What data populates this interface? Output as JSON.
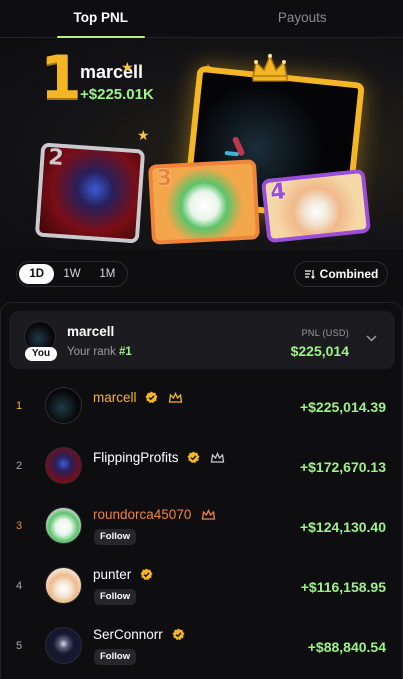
{
  "tabs": [
    "Top PNL",
    "Payouts"
  ],
  "hero": {
    "rank": "1",
    "name": "marcell",
    "pnl": "+$225.01K",
    "cards": [
      "2",
      "3",
      "4"
    ]
  },
  "filters": {
    "ranges": [
      "1D",
      "1W",
      "1M"
    ],
    "active_range": "1D",
    "combined_label": "Combined"
  },
  "you": {
    "name": "marcell",
    "badge": "You",
    "rank_label": "Your rank",
    "rank_value": "#1",
    "pnl_label": "PNL (USD)",
    "pnl": "$225,014"
  },
  "rows": [
    {
      "rank": "1",
      "name": "marcell",
      "pnl": "+$225,014.39",
      "verified": true,
      "crown": true,
      "follow": ""
    },
    {
      "rank": "2",
      "name": "FlippingProfits",
      "pnl": "+$172,670.13",
      "verified": true,
      "crown": true,
      "follow": ""
    },
    {
      "rank": "3",
      "name": "roundorca45070",
      "pnl": "+$124,130.40",
      "verified": false,
      "crown": true,
      "follow": "Follow"
    },
    {
      "rank": "4",
      "name": "punter",
      "pnl": "+$116,158.95",
      "verified": true,
      "crown": false,
      "follow": "Follow"
    },
    {
      "rank": "5",
      "name": "SerConnorr",
      "pnl": "+$88,840.54",
      "verified": true,
      "crown": false,
      "follow": "Follow"
    }
  ],
  "colors": {
    "accent_green": "#9ef28a",
    "gold": "#f4b624",
    "bronze": "#f0833a",
    "purple": "#9b4fd8",
    "background": "#0e0e10"
  },
  "icons": [
    "verified-badge-icon",
    "crown-icon",
    "chevron-down-icon",
    "combined-sort-icon",
    "star-icon"
  ]
}
